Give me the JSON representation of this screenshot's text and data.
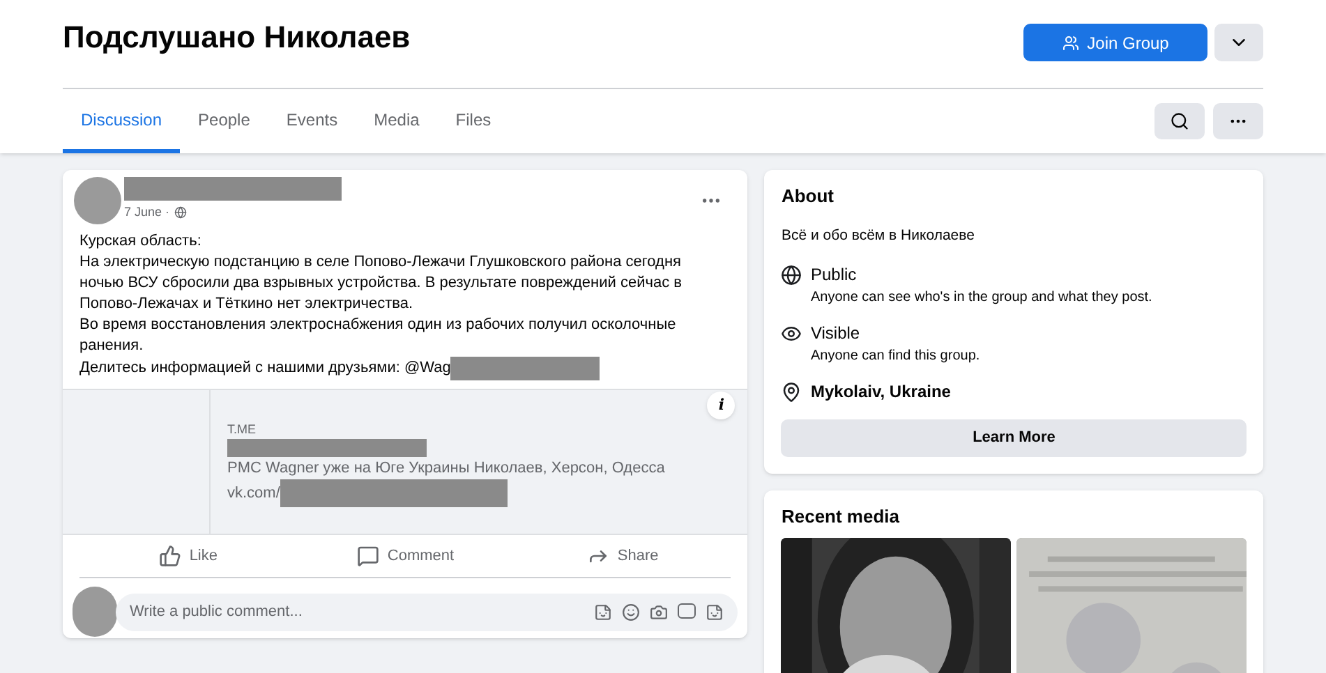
{
  "group": {
    "title": "Подслушано Николаев",
    "join_button": "Join Group"
  },
  "tabs": [
    {
      "label": "Discussion",
      "selected": true
    },
    {
      "label": "People",
      "selected": false
    },
    {
      "label": "Events",
      "selected": false
    },
    {
      "label": "Media",
      "selected": false
    },
    {
      "label": "Files",
      "selected": false
    }
  ],
  "post": {
    "date": "7 June",
    "date_separator": "·",
    "lines": [
      "Курская область:",
      "На электрическую подстанцию в селе Попово-Лежачи Глушковского района сегодня ночью ВСУ сбросили два взрывных устройства. В результате повреждений сейчас в Попово-Лежачах и Тёткино нет электричества.",
      "Во время восстановления электроснабжения один из рабочих получил осколочные ранения."
    ],
    "mention_line": "Делитесь информацией с нашими друзьями: @Wag",
    "link_preview": {
      "domain": "T.ME",
      "info_icon": "i",
      "description": "PMC Wagner уже на Юге Украины Николаев, Херсон, Одесса",
      "url": "vk.com/"
    },
    "actions": [
      {
        "kind": "like",
        "label": "Like"
      },
      {
        "kind": "comment",
        "label": "Comment"
      },
      {
        "kind": "share",
        "label": "Share"
      }
    ],
    "comment_placeholder": "Write a public comment..."
  },
  "about": {
    "title": "About",
    "description": "Всё и обо всём в Николаеве",
    "items": [
      {
        "kind": "globe",
        "title": "Public",
        "text": "Anyone can see who's in the group and what they post."
      },
      {
        "kind": "eye",
        "title": "Visible",
        "text": "Anyone can find this group."
      },
      {
        "kind": "pin",
        "title": "Mykolaiv, Ukraine"
      }
    ],
    "button": "Learn More"
  },
  "recent_media": {
    "title": "Recent media"
  }
}
